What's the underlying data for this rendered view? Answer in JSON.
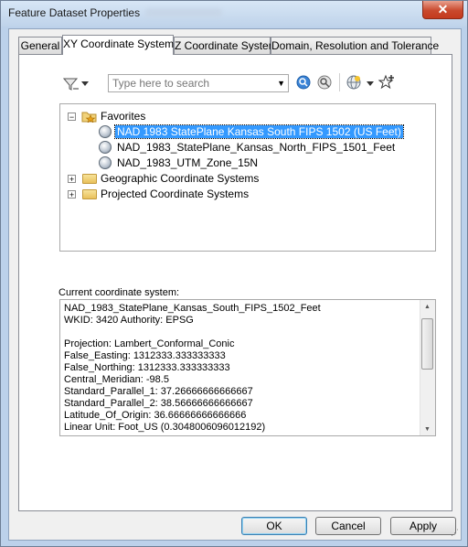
{
  "window": {
    "title": "Feature Dataset Properties",
    "close_glyph": "✕"
  },
  "tabs": [
    {
      "label": "General"
    },
    {
      "label": "XY Coordinate System"
    },
    {
      "label": "Z Coordinate System"
    },
    {
      "label": "Domain, Resolution and Tolerance"
    }
  ],
  "toolbar": {
    "search_placeholder": "Type here to search",
    "icons": [
      "filter-icon",
      "dropdown-arrow-icon",
      "search-icon",
      "clear-search-icon",
      "globe-add-icon",
      "favorite-add-icon"
    ]
  },
  "tree": {
    "favorites": {
      "label": "Favorites",
      "expander": "−",
      "items": [
        {
          "label": "NAD 1983 StatePlane Kansas South FIPS 1502 (US Feet)"
        },
        {
          "label": "NAD_1983_StatePlane_Kansas_North_FIPS_1501_Feet"
        },
        {
          "label": "NAD_1983_UTM_Zone_15N"
        }
      ]
    },
    "geographic": {
      "label": "Geographic Coordinate Systems",
      "expander": "+"
    },
    "projected": {
      "label": "Projected Coordinate Systems",
      "expander": "+"
    }
  },
  "current": {
    "label": "Current coordinate system:",
    "lines": [
      "NAD_1983_StatePlane_Kansas_South_FIPS_1502_Feet",
      "WKID: 3420 Authority: EPSG",
      "",
      "Projection: Lambert_Conformal_Conic",
      "False_Easting: 1312333.333333333",
      "False_Northing: 1312333.333333333",
      "Central_Meridian: -98.5",
      "Standard_Parallel_1: 37.26666666666667",
      "Standard_Parallel_2: 38.56666666666667",
      "Latitude_Of_Origin: 36.66666666666666",
      "Linear Unit: Foot_US (0.3048006096012192)"
    ]
  },
  "buttons": {
    "ok": "OK",
    "cancel": "Cancel",
    "apply": "Apply"
  },
  "colors": {
    "selection": "#3399ff",
    "close": "#c9492d"
  }
}
